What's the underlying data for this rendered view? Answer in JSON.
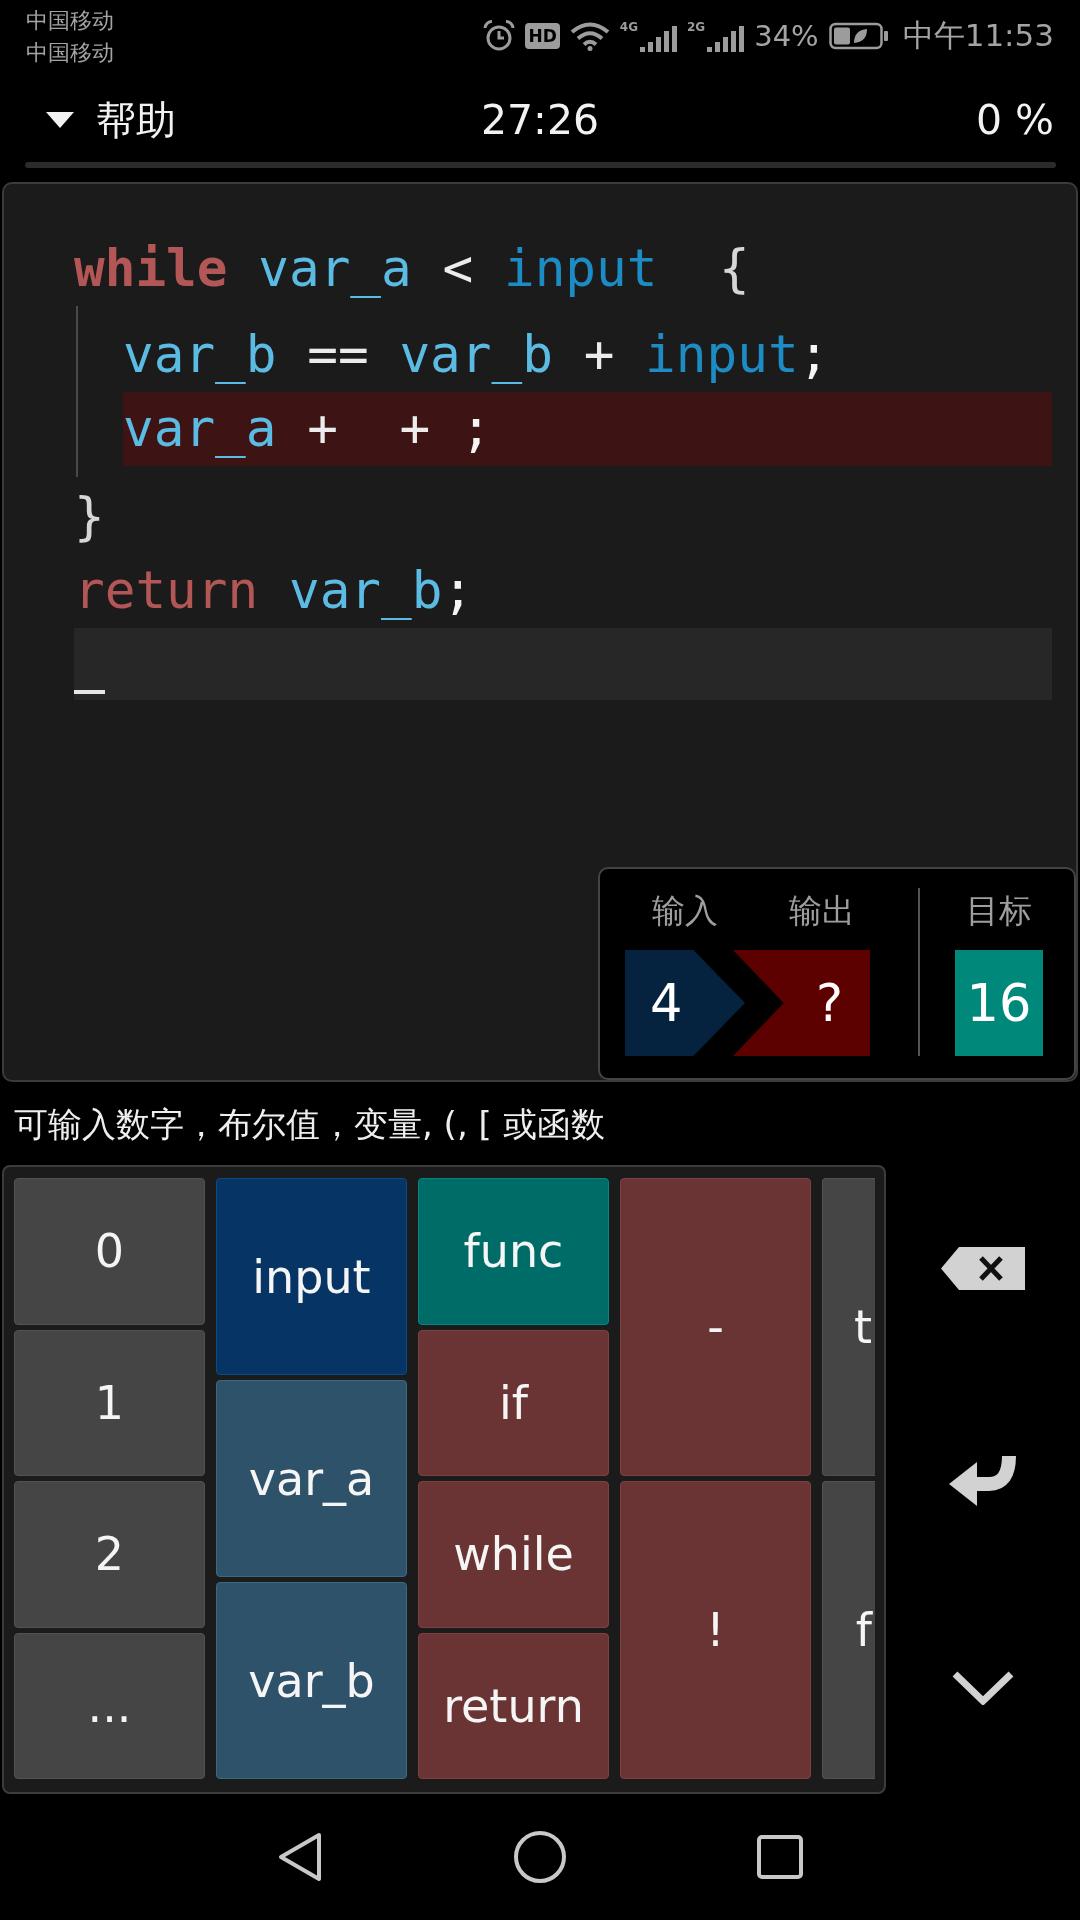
{
  "status_bar": {
    "carriers": [
      "中国移动",
      "中国移动"
    ],
    "hd_label": "HD",
    "networks": [
      "4G",
      "2G"
    ],
    "battery": "34%",
    "time": "中午11:53"
  },
  "header": {
    "menu_label": "帮助",
    "timer": "27:26",
    "progress": "0 %"
  },
  "code": {
    "lines": [
      {
        "error": false,
        "tokens": [
          {
            "kind": "keyword",
            "text": "**while**"
          },
          {
            "kind": "variable",
            "text": "var_a"
          },
          {
            "kind": "operator",
            "text": "<"
          },
          {
            "kind": "input",
            "text": "input"
          },
          {
            "kind": "blank"
          },
          {
            "kind": "brace",
            "text": "{"
          }
        ],
        "children": [
          {
            "error": false,
            "tokens": [
              {
                "kind": "variable",
                "text": "var_b"
              },
              {
                "kind": "operator",
                "text": "=="
              },
              {
                "kind": "variable",
                "text": "var_b"
              },
              {
                "kind": "operator",
                "text": "+"
              },
              {
                "kind": "input",
                "text": "input"
              },
              {
                "kind": "end",
                "text": ";"
              }
            ]
          },
          {
            "error": true,
            "tokens": [
              {
                "kind": "variable",
                "text": "var_a"
              },
              {
                "kind": "operator",
                "text": "+"
              },
              {
                "kind": "blank"
              },
              {
                "kind": "operator",
                "text": "+"
              },
              {
                "kind": "blank"
              },
              {
                "kind": "end",
                "text": ";"
              }
            ]
          }
        ],
        "closing": [
          {
            "kind": "brace",
            "text": "}"
          }
        ]
      },
      {
        "error": false,
        "tokens": [
          {
            "kind": "keyword",
            "text": "return"
          },
          {
            "kind": "variable",
            "text": "var_b"
          },
          {
            "kind": "end",
            "text": ";"
          }
        ]
      }
    ]
  },
  "io": {
    "input": {
      "label": "输入",
      "value": "4"
    },
    "output": {
      "label": "输出",
      "value": "?"
    },
    "target": {
      "label": "目标",
      "value": "16"
    }
  },
  "hint": "可输入数字，布尔值，变量, (, [ 或函数",
  "keyboard": {
    "columns": [
      {
        "keys": [
          {
            "kind": "number",
            "label": "0"
          },
          {
            "kind": "number",
            "label": "1"
          },
          {
            "kind": "number",
            "label": "2"
          },
          {
            "kind": "more",
            "label": "..."
          }
        ]
      },
      {
        "keys": [
          {
            "kind": "input",
            "label": "input"
          },
          {
            "kind": "variable",
            "label": "var_a"
          },
          {
            "kind": "variable",
            "label": "var_b"
          }
        ]
      },
      {
        "keys": [
          {
            "kind": "function",
            "label": "func"
          },
          {
            "kind": "keyword",
            "label": "if"
          },
          {
            "kind": "keyword",
            "label": "while"
          },
          {
            "kind": "keyword",
            "label": "return"
          }
        ]
      },
      {
        "keys": [
          {
            "kind": "operator",
            "label": "-"
          },
          {
            "kind": "operator",
            "label": "!"
          }
        ]
      },
      {
        "keys": [
          {
            "kind": "boolean",
            "label": "t"
          },
          {
            "kind": "boolean",
            "label": "f"
          }
        ]
      }
    ]
  }
}
